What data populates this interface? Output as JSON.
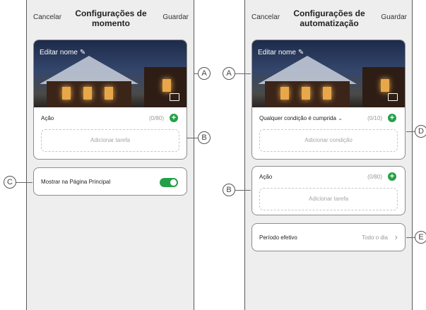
{
  "left_screen": {
    "cancel": "Cancelar",
    "title": "Configurações de momento",
    "save": "Guardar",
    "edit_name": "Editar nome",
    "action_label": "Ação",
    "action_count": "(0/80)",
    "add_task": "Adicionar tarefa",
    "show_home_label": "Mostrar na Página Principal",
    "show_home_enabled": true
  },
  "right_screen": {
    "cancel": "Cancelar",
    "title": "Configurações de automatização",
    "save": "Guardar",
    "edit_name": "Editar nome",
    "condition_label": "Qualquer condição é cumprida",
    "condition_count": "(0/10)",
    "add_condition": "Adicionar condição",
    "action_label": "Ação",
    "action_count": "(0/80)",
    "add_task": "Adicionar tarefa",
    "period_label": "Período efetivo",
    "period_value": "Todo o dia"
  },
  "callouts": {
    "a": "A",
    "b": "B",
    "c": "C",
    "d": "D",
    "e": "E"
  },
  "icons": {
    "edit": "pencil-icon",
    "image": "image-icon",
    "add": "plus-circle-icon",
    "dropdown": "chevron-down-icon",
    "next": "chevron-right-icon"
  },
  "colors": {
    "accent_green": "#24a049"
  }
}
